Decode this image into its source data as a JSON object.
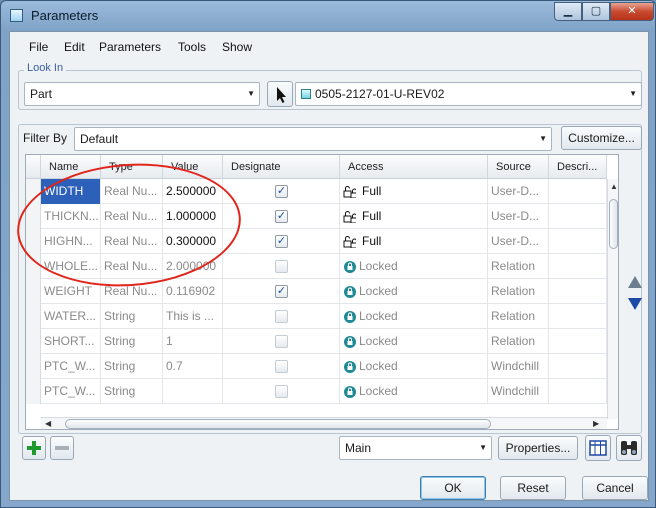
{
  "window": {
    "title": "Parameters"
  },
  "menu": [
    "File",
    "Edit",
    "Parameters",
    "Tools",
    "Show"
  ],
  "look_in": {
    "legend": "Look In",
    "type_value": "Part",
    "object_value": "0505-2127-01-U-REV02"
  },
  "filter": {
    "label": "Filter By",
    "value": "Default",
    "customize_label": "Customize..."
  },
  "columns": [
    "Name",
    "Type",
    "Value",
    "Designate",
    "Access",
    "Source",
    "Descri..."
  ],
  "rows": [
    {
      "name": "WIDTH",
      "type": "Real Nu...",
      "value": "2.500000",
      "designate": true,
      "access": "Full",
      "source": "User-D...",
      "selected": true
    },
    {
      "name": "THICKN...",
      "type": "Real Nu...",
      "value": "1.000000",
      "designate": true,
      "access": "Full",
      "source": "User-D..."
    },
    {
      "name": "HIGHN...",
      "type": "Real Nu...",
      "value": "0.300000",
      "designate": true,
      "access": "Full",
      "source": "User-D..."
    },
    {
      "name": "WHOLE...",
      "type": "Real Nu...",
      "value": "2.000000",
      "designate": false,
      "access": "Locked",
      "source": "Relation"
    },
    {
      "name": "WEIGHT",
      "type": "Real Nu...",
      "value": "0.116902",
      "designate": true,
      "access": "Locked",
      "source": "Relation"
    },
    {
      "name": "WATER...",
      "type": "String",
      "value": "This is ...",
      "designate": false,
      "access": "Locked",
      "source": "Relation"
    },
    {
      "name": "SHORT...",
      "type": "String",
      "value": "1",
      "designate": false,
      "access": "Locked",
      "source": "Relation"
    },
    {
      "name": "PTC_W...",
      "type": "String",
      "value": "0.7",
      "designate": false,
      "access": "Locked",
      "source": "Windchill"
    },
    {
      "name": "PTC_W...",
      "type": "String",
      "value": "",
      "designate": false,
      "access": "Locked",
      "source": "Windchill"
    }
  ],
  "bottom": {
    "add_icon": "plus-icon",
    "remove_icon": "minus-icon",
    "view_select": "Main",
    "properties_label": "Properties...",
    "table_icon": "table-icon",
    "binoculars_icon": "binoculars-icon"
  },
  "buttons": {
    "ok": "OK",
    "reset": "Reset",
    "cancel": "Cancel"
  },
  "colors": {
    "selection": "#2d60b8",
    "annotation": "#e0251b",
    "locked_icon": "#1f8a95"
  }
}
